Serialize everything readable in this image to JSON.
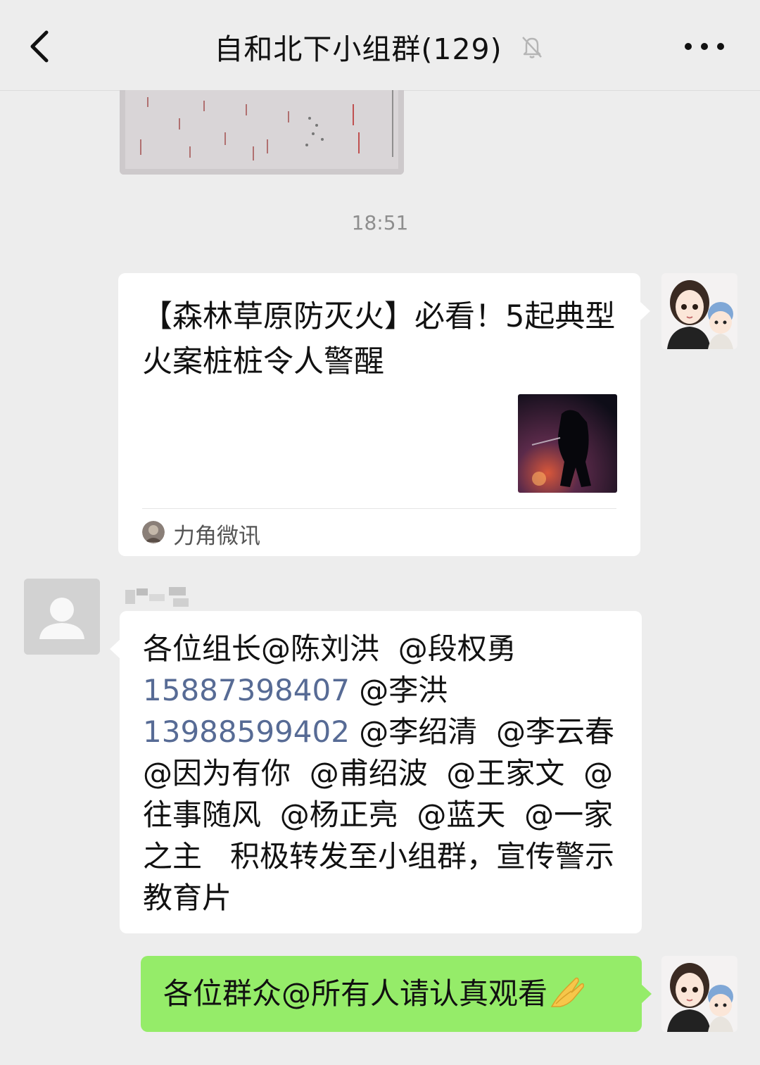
{
  "header": {
    "title": "自和北下小组群(129)",
    "back_icon": "chevron-left-icon",
    "mute_icon": "bell-off-icon",
    "more_icon": "more-horizontal-icon"
  },
  "messages": {
    "timestamp": "18:51",
    "article_card": {
      "title": "【森林草原防灭火】必看！5起典型火案桩桩令人警醒",
      "source": "力角微讯"
    },
    "text_message": {
      "parts": [
        "各位组长@陈刘洪  @段权勇 ",
        "15887398407",
        " @李洪 ",
        "13988599402",
        " @李绍清  @李云春  @因为有你  @甫绍波  @王家文  @往事随风  @杨正亮  @蓝天  @一家之主   积极转发至小组群，宣传警示教育片"
      ]
    },
    "green_message": {
      "text": "各位群众@所有人请认真观看",
      "emoji": "praying-hands-icon"
    }
  },
  "colors": {
    "background": "#ededed",
    "bubble_self": "#95ec69",
    "bubble_other": "#ffffff",
    "phone_link": "#576b95",
    "timestamp": "#8e8e8e"
  }
}
